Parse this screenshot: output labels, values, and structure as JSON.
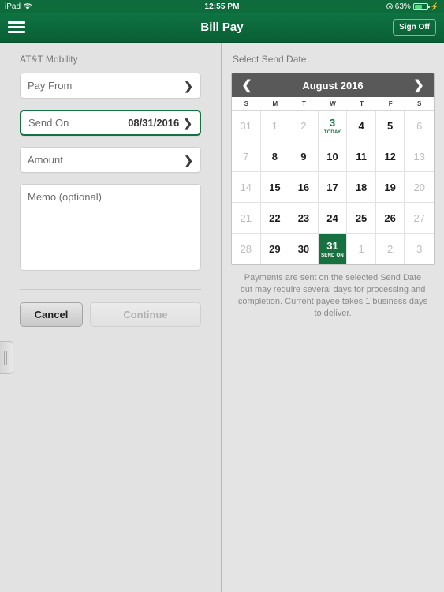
{
  "statusbar": {
    "device": "iPad",
    "wifi_icon": "wifi-icon",
    "time": "12:55 PM",
    "location_icon": "location-services-icon",
    "battery_percent": "63%",
    "battery_level": 63,
    "charging_icon": "lightning-bolt-icon"
  },
  "navbar": {
    "menu_icon": "hamburger-menu-icon",
    "title": "Bill Pay",
    "signoff_label": "Sign Off"
  },
  "form": {
    "payee_label": "AT&T Mobility",
    "fields": [
      {
        "label": "Pay From",
        "value": "",
        "chevron": "chevron-right-icon",
        "active": false
      },
      {
        "label": "Send On",
        "value": "08/31/2016",
        "chevron": "chevron-right-icon",
        "active": true
      },
      {
        "label": "Amount",
        "value": "",
        "chevron": "chevron-right-icon",
        "active": false
      }
    ],
    "memo_placeholder": "Memo (optional)",
    "memo_value": "",
    "cancel_label": "Cancel",
    "continue_label": "Continue",
    "drag_handle_icon": "drag-handle-icon"
  },
  "calendar": {
    "section_label": "Select Send Date",
    "prev_icon": "chevron-left-icon",
    "next_icon": "chevron-right-icon",
    "month_title": "August 2016",
    "dow": [
      "S",
      "M",
      "T",
      "W",
      "T",
      "F",
      "S"
    ],
    "weeks": [
      [
        {
          "d": "31",
          "state": "dim"
        },
        {
          "d": "1",
          "state": "dim"
        },
        {
          "d": "2",
          "state": "dim"
        },
        {
          "d": "3",
          "state": "today",
          "tag": "TODAY"
        },
        {
          "d": "4",
          "state": "normal"
        },
        {
          "d": "5",
          "state": "normal"
        },
        {
          "d": "6",
          "state": "dim"
        }
      ],
      [
        {
          "d": "7",
          "state": "dim"
        },
        {
          "d": "8",
          "state": "normal"
        },
        {
          "d": "9",
          "state": "normal"
        },
        {
          "d": "10",
          "state": "normal"
        },
        {
          "d": "11",
          "state": "normal"
        },
        {
          "d": "12",
          "state": "normal"
        },
        {
          "d": "13",
          "state": "dim"
        }
      ],
      [
        {
          "d": "14",
          "state": "dim"
        },
        {
          "d": "15",
          "state": "normal"
        },
        {
          "d": "16",
          "state": "normal"
        },
        {
          "d": "17",
          "state": "normal"
        },
        {
          "d": "18",
          "state": "normal"
        },
        {
          "d": "19",
          "state": "normal"
        },
        {
          "d": "20",
          "state": "dim"
        }
      ],
      [
        {
          "d": "21",
          "state": "dim"
        },
        {
          "d": "22",
          "state": "normal"
        },
        {
          "d": "23",
          "state": "normal"
        },
        {
          "d": "24",
          "state": "normal"
        },
        {
          "d": "25",
          "state": "normal"
        },
        {
          "d": "26",
          "state": "normal"
        },
        {
          "d": "27",
          "state": "dim"
        }
      ],
      [
        {
          "d": "28",
          "state": "dim"
        },
        {
          "d": "29",
          "state": "normal"
        },
        {
          "d": "30",
          "state": "normal"
        },
        {
          "d": "31",
          "state": "selected",
          "tag": "SEND ON"
        },
        {
          "d": "1",
          "state": "dim"
        },
        {
          "d": "2",
          "state": "dim"
        },
        {
          "d": "3",
          "state": "dim"
        }
      ]
    ],
    "note": "Payments are sent on the selected Send Date but may require several days for processing and completion. Current payee takes 1 business days to deliver."
  },
  "colors": {
    "brand_green": "#0d6b3c",
    "selected_green": "#16703f",
    "calendar_header_gray": "#595959",
    "page_bg": "#e2e2e2"
  }
}
